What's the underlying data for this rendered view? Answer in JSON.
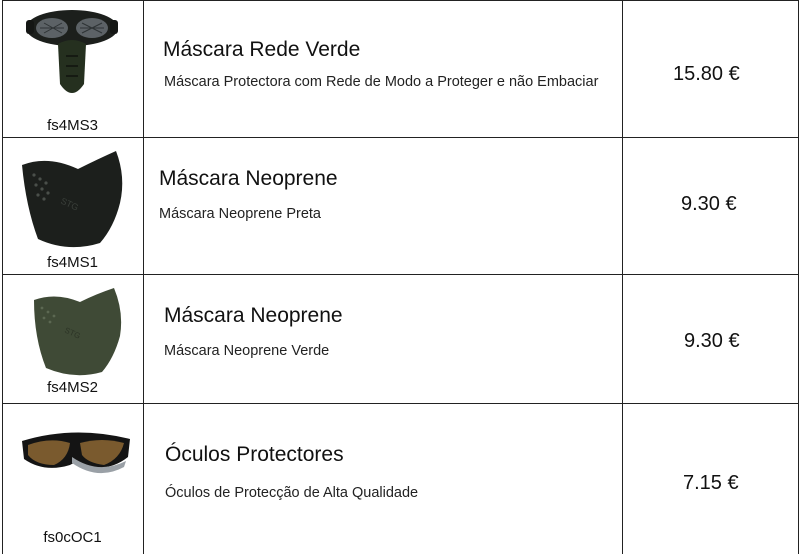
{
  "products": [
    {
      "code": "fs4MS3",
      "name": "Máscara Rede Verde",
      "description": "Máscara Protectora com Rede de Modo a Proteger e não Embaciar",
      "price": "15.80 €",
      "image_icon": "mesh-mask-icon"
    },
    {
      "code": "fs4MS1",
      "name": "Máscara Neoprene",
      "description": "Máscara Neoprene Preta",
      "price": "9.30 €",
      "image_icon": "black-neoprene-mask-icon"
    },
    {
      "code": "fs4MS2",
      "name": "Máscara Neoprene",
      "description": "Máscara Neoprene Verde",
      "price": "9.30 €",
      "image_icon": "green-neoprene-mask-icon"
    },
    {
      "code": "fs0cOC1",
      "name": "Óculos Protectores",
      "description": "Óculos de Protecção de Alta Qualidade",
      "price": "7.15 €",
      "image_icon": "protective-goggles-icon"
    }
  ],
  "colors": {
    "border": "#222222",
    "mask_black": "#1c1f1c",
    "mask_green": "#3f4a36",
    "lens_brown": "#7a5a2e"
  }
}
